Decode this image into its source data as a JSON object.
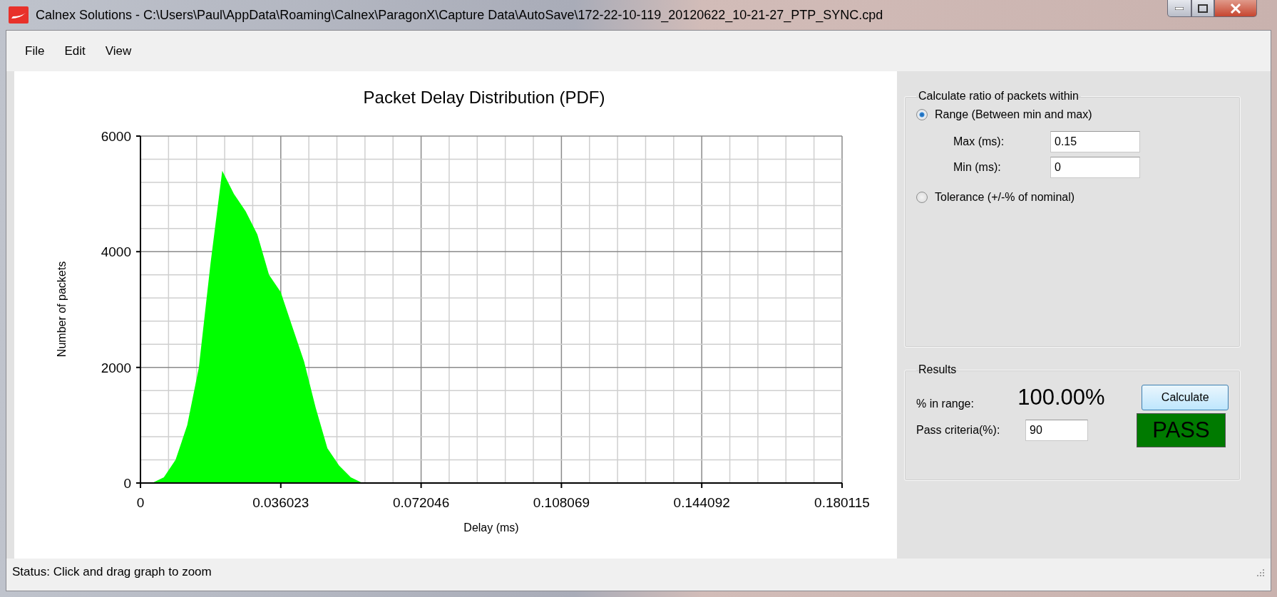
{
  "window": {
    "title": "Calnex Solutions - C:\\Users\\Paul\\AppData\\Roaming\\Calnex\\ParagonX\\Capture Data\\AutoSave\\172-22-10-119_20120622_10-21-27_PTP_SYNC.cpd"
  },
  "menu": [
    "File",
    "Edit",
    "View"
  ],
  "chart": {
    "chart_data": {
      "type": "area",
      "title": "Packet Delay Distribution (PDF)",
      "xlabel": "Delay (ms)",
      "ylabel": "Number of packets",
      "x": [
        0,
        0.003,
        0.006,
        0.009,
        0.012,
        0.015,
        0.018,
        0.021,
        0.024,
        0.027,
        0.03,
        0.033,
        0.036,
        0.039,
        0.042,
        0.045,
        0.048,
        0.051,
        0.054,
        0.057,
        0.06,
        0.063,
        0.066,
        0.072,
        0.09,
        0.108,
        0.126,
        0.144,
        0.162,
        0.18
      ],
      "series": [
        {
          "color": "#00ff00",
          "values": [
            0,
            0,
            100,
            400,
            1000,
            2000,
            3800,
            5400,
            5000,
            4700,
            4300,
            3600,
            3300,
            2700,
            2100,
            1300,
            600,
            300,
            100,
            0,
            0,
            0,
            0,
            0,
            0,
            0,
            0,
            0,
            0,
            0
          ]
        }
      ],
      "grid": true,
      "xlim": [
        0,
        0.180115
      ],
      "ylim": [
        0,
        6000
      ],
      "xticks": [
        0,
        0.036023,
        0.072046,
        0.108069,
        0.144092,
        0.180115
      ],
      "yticks": [
        0,
        2000,
        4000,
        6000
      ]
    }
  },
  "range_panel": {
    "title": "Calculate ratio of packets within",
    "options": [
      {
        "label": "Range (Between min and max)",
        "selected": true
      },
      {
        "label": "Tolerance (+/-% of nominal)",
        "selected": false
      }
    ],
    "fields": [
      {
        "label": "Max (ms):",
        "value": "0.15"
      },
      {
        "label": "Min (ms):",
        "value": "0"
      }
    ]
  },
  "results": {
    "title": "Results",
    "in_range_label": "% in range:",
    "in_range_value": "100.00%",
    "button": "Calculate",
    "pass_label": "Pass criteria(%):",
    "pass_value": "90",
    "verdict": {
      "text": "PASS",
      "kind": "pass"
    }
  },
  "status_bar": "Status: Click and drag graph to zoom"
}
